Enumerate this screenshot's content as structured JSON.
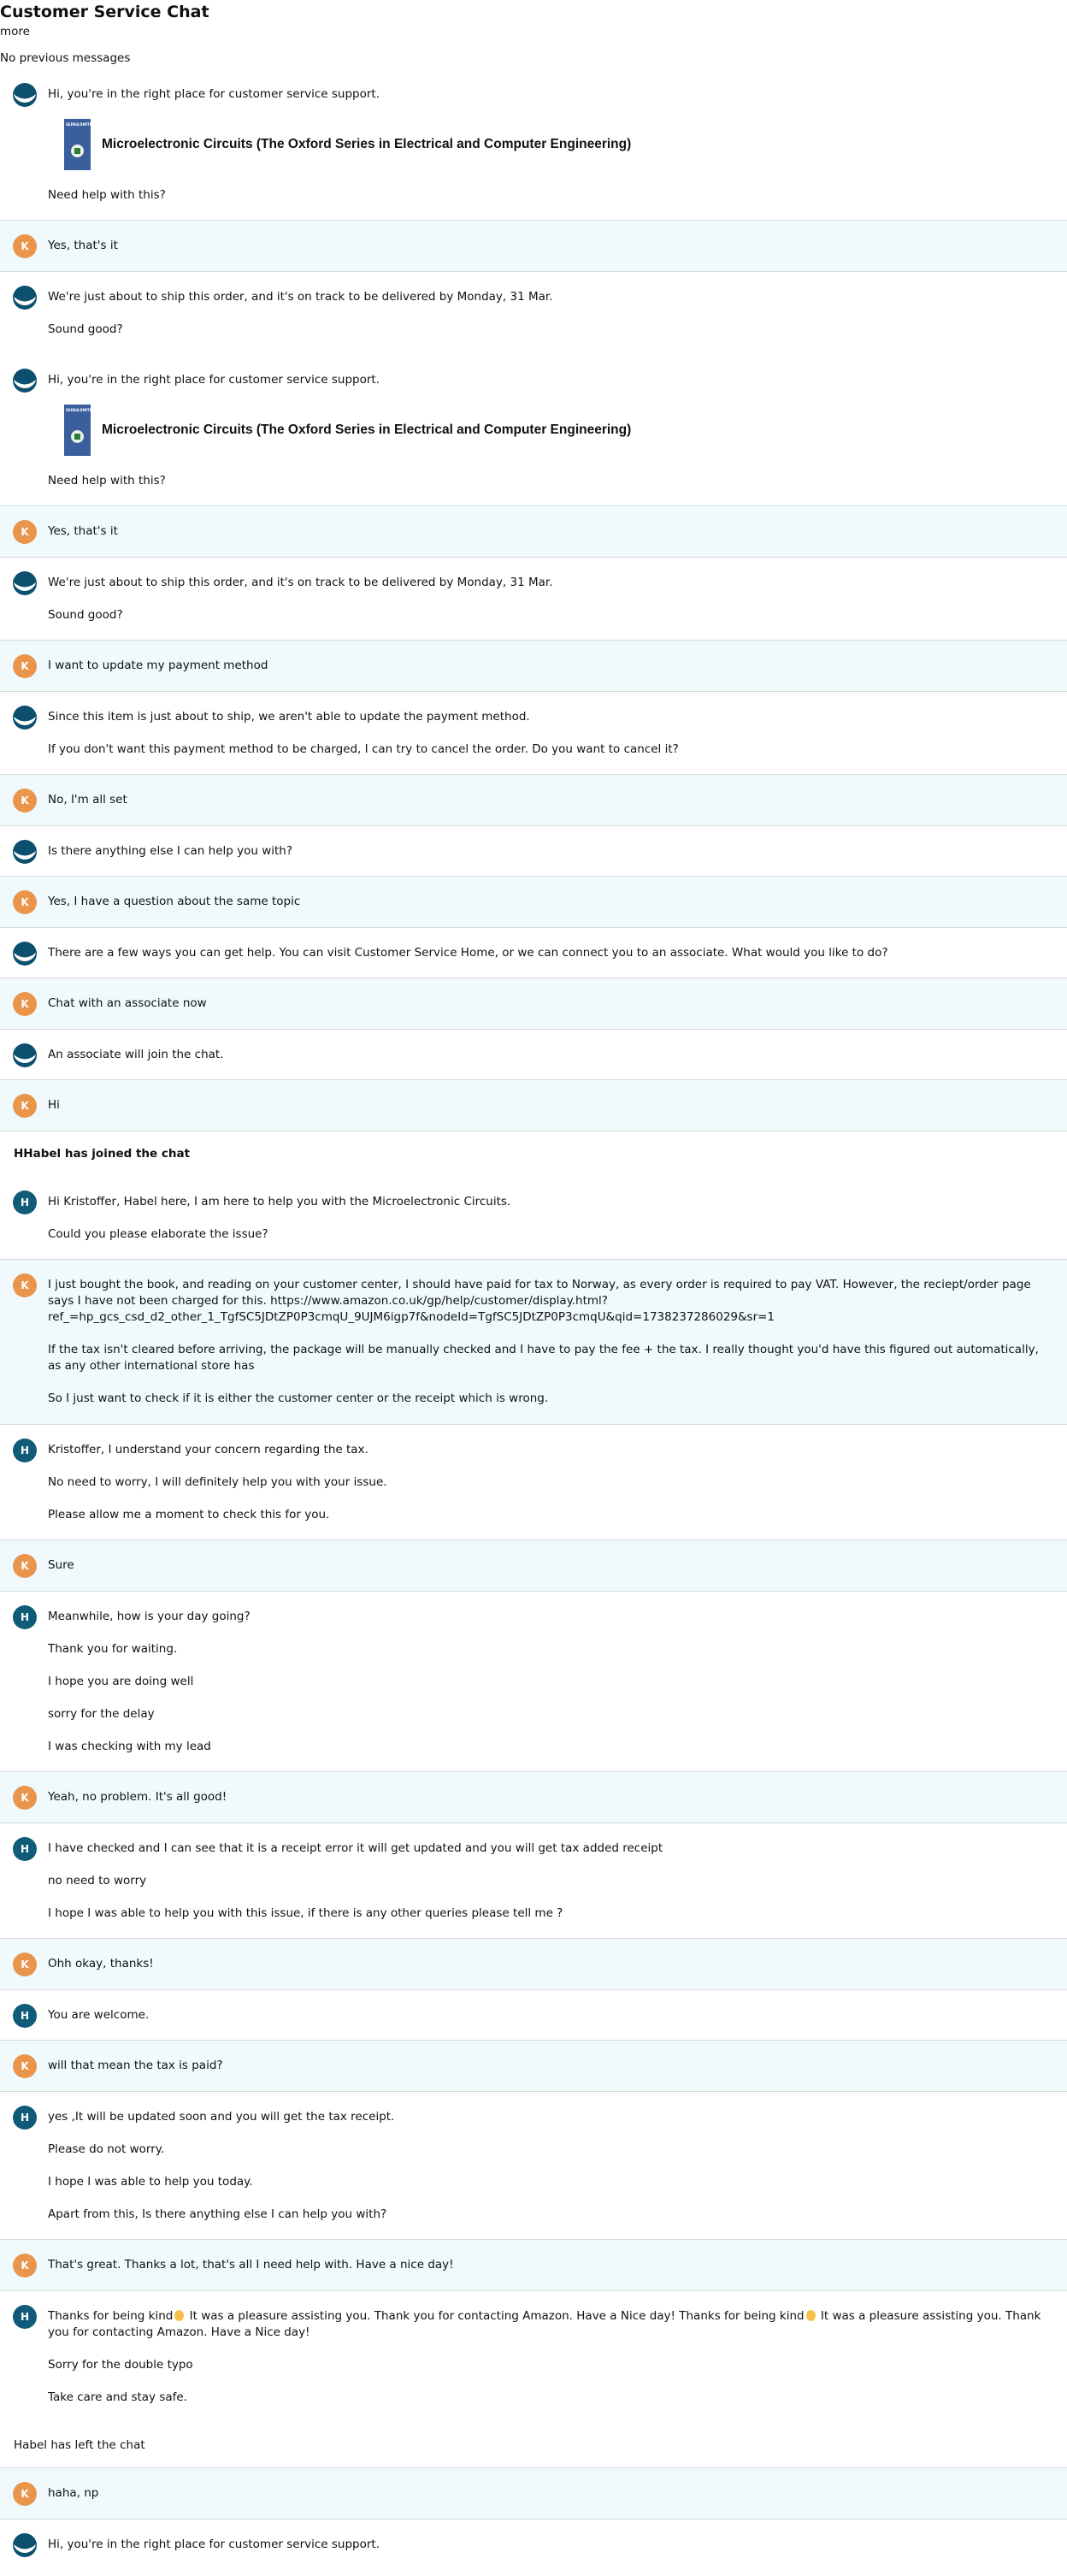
{
  "header": {
    "title": "Customer Service Chat",
    "more": "more",
    "no_previous": "No previous messages"
  },
  "colors": {
    "user_bg": "#f0fafd",
    "k_avatar": "#e9954c",
    "h_avatar": "#0f5b78",
    "bot_avatar": "#0c4f6e"
  },
  "product": {
    "title": "Microelectronic Circuits (The Oxford Series in Electrical and Computer Engineering)",
    "cover_text": "SEDRA/SMITH"
  },
  "messages": [
    {
      "type": "bot",
      "paras": [
        "Hi, you're in the right place for customer service support."
      ],
      "card": true,
      "after": [
        "Need help with this?"
      ]
    },
    {
      "type": "k",
      "initial": "K",
      "paras": [
        "Yes, that's it"
      ]
    },
    {
      "type": "bot",
      "paras": [
        "We're just about to ship this order, and it's on track to be delivered by Monday, 31 Mar.",
        "Sound good?"
      ]
    },
    {
      "type": "bot",
      "paras": [
        "Hi, you're in the right place for customer service support."
      ],
      "card": true,
      "after": [
        "Need help with this?"
      ]
    },
    {
      "type": "k",
      "initial": "K",
      "paras": [
        "Yes, that's it"
      ]
    },
    {
      "type": "bot",
      "paras": [
        "We're just about to ship this order, and it's on track to be delivered by Monday, 31 Mar.",
        "Sound good?"
      ]
    },
    {
      "type": "k",
      "initial": "K",
      "paras": [
        "I want to update my payment method"
      ]
    },
    {
      "type": "bot",
      "paras": [
        "Since this item is just about to ship, we aren't able to update the payment method.",
        "If you don't want this payment method to be charged, I can try to cancel the order. Do you want to cancel it?"
      ]
    },
    {
      "type": "k",
      "initial": "K",
      "paras": [
        "No, I'm all set"
      ]
    },
    {
      "type": "bot",
      "paras": [
        "Is there anything else I can help you with?"
      ]
    },
    {
      "type": "k",
      "initial": "K",
      "paras": [
        "Yes, I have a question about the same topic"
      ]
    },
    {
      "type": "bot",
      "paras": [
        "There are a few ways you can get help. You can visit Customer Service Home, or we can connect you to an associate. What would you like to do?"
      ]
    },
    {
      "type": "k",
      "initial": "K",
      "paras": [
        "Chat with an associate now"
      ]
    },
    {
      "type": "bot",
      "paras": [
        "An associate will join the chat."
      ]
    },
    {
      "type": "k",
      "initial": "K",
      "paras": [
        "Hi"
      ]
    },
    {
      "type": "sys",
      "paras": [
        "HHabel has joined the chat"
      ]
    },
    {
      "type": "h",
      "initial": "H",
      "paras": [
        "Hi Kristoffer, Habel here, I am here to help you with the Microelectronic Circuits.",
        "Could you please elaborate the issue?"
      ]
    },
    {
      "type": "k",
      "initial": "K",
      "paras": [
        "I just bought the book, and reading on your customer center, I should have paid for tax to Norway, as every order is required to pay VAT. However, the reciept/order page says I have not been charged for this. https://www.amazon.co.uk/gp/help/customer/display.html?ref_=hp_gcs_csd_d2_other_1_TgfSC5JDtZP0P3cmqU_9UJM6igp7f&nodeId=TgfSC5JDtZP0P3cmqU&qid=1738237286029&sr=1",
        "If the tax isn't cleared before arriving, the package will be manually checked and I have to pay the fee + the tax. I really thought you'd have this figured out automatically, as any other international store has",
        "So I just want to check if it is either the customer center or the receipt which is wrong."
      ]
    },
    {
      "type": "h",
      "initial": "H",
      "paras": [
        "Kristoffer, I understand your concern regarding the tax.",
        "No need to worry, I will definitely help you with your issue.",
        "Please allow me a moment to check this for you."
      ]
    },
    {
      "type": "k",
      "initial": "K",
      "paras": [
        "Sure"
      ]
    },
    {
      "type": "h",
      "initial": "H",
      "paras": [
        "Meanwhile, how is your day going?",
        "Thank you for waiting.",
        "I hope you are doing well",
        "sorry for the delay",
        "I was checking with my lead"
      ]
    },
    {
      "type": "k",
      "initial": "K",
      "paras": [
        "Yeah, no problem. It's all good!"
      ]
    },
    {
      "type": "h",
      "initial": "H",
      "paras": [
        "I have checked and I can see that it is a receipt error it will get updated and you will get tax added receipt",
        "no need to worry",
        "I hope I was able to help you with this issue, if there is any other queries please tell me ?"
      ]
    },
    {
      "type": "k",
      "initial": "K",
      "paras": [
        "Ohh okay, thanks!"
      ]
    },
    {
      "type": "h",
      "initial": "H",
      "paras": [
        "You are welcome."
      ]
    },
    {
      "type": "k",
      "initial": "K",
      "paras": [
        "will that mean the tax is paid?"
      ]
    },
    {
      "type": "h",
      "initial": "H",
      "paras": [
        "yes ,It will be updated soon and you will get the tax receipt.",
        "Please do not worry.",
        "I hope I was able to help you today.",
        "Apart from this, Is there anything else I can help you with?"
      ]
    },
    {
      "type": "k",
      "initial": "K",
      "paras": [
        "That's great. Thanks a lot, that's all I need help with. Have a nice day!"
      ]
    },
    {
      "type": "h",
      "initial": "H",
      "paras": [
        [
          "Thanks for being kind",
          " It was a pleasure assisting you. Thank you for contacting Amazon. Have a Nice day! Thanks for being kind",
          " It was a pleasure assisting you. Thank you for contacting Amazon. Have a Nice day!"
        ],
        "Sorry for the double typo",
        "Take care and stay safe."
      ]
    },
    {
      "type": "sys",
      "left": true,
      "paras": [
        "Habel has left the chat"
      ]
    },
    {
      "type": "k",
      "initial": "K",
      "paras": [
        "haha, np"
      ]
    },
    {
      "type": "bot",
      "paras": [
        "Hi, you're in the right place for customer service support."
      ]
    }
  ]
}
